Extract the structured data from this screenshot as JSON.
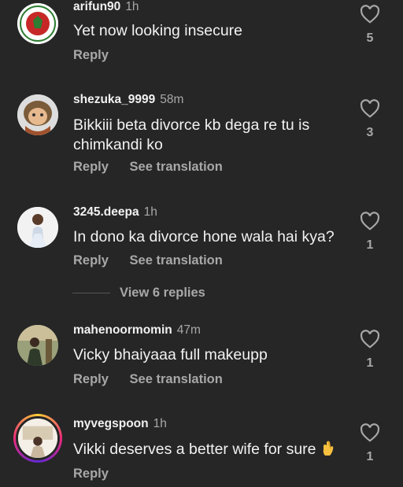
{
  "comments": [
    {
      "username": "arifun90",
      "time": "1h",
      "text": "Yet now looking insecure",
      "actions": [
        "Reply"
      ],
      "likes": "5",
      "avatar": "bangladesh-emblem-icon"
    },
    {
      "username": "shezuka_9999",
      "time": "58m",
      "text": "Bikkiii beta divorce kb dega re tu is chimkandi ko",
      "actions": [
        "Reply",
        "See translation"
      ],
      "likes": "3",
      "avatar": "cartoon-character-icon"
    },
    {
      "username": "3245.deepa",
      "time": "1h",
      "text": "In dono ka divorce hone wala hai kya?",
      "actions": [
        "Reply",
        "See translation"
      ],
      "likes": "1",
      "avatar": "woman-photo"
    },
    {
      "username": "mahenoormomin",
      "time": "47m",
      "text": "Vicky bhaiyaaa full makeupp",
      "actions": [
        "Reply",
        "See translation"
      ],
      "likes": "1",
      "avatar": "person-outdoor-photo"
    },
    {
      "username": "myvegspoon",
      "time": "1h",
      "text": "Vikki deserves a better wife for sure",
      "emoji": "crossed-fingers-emoji",
      "actions": [
        "Reply"
      ],
      "likes": "1",
      "avatar": "story-ring-photo"
    }
  ],
  "view_replies": "View 6 replies",
  "colors": {
    "background": "#262626",
    "primary_text": "#f5f5f5",
    "secondary_text": "#a8a8a8"
  }
}
